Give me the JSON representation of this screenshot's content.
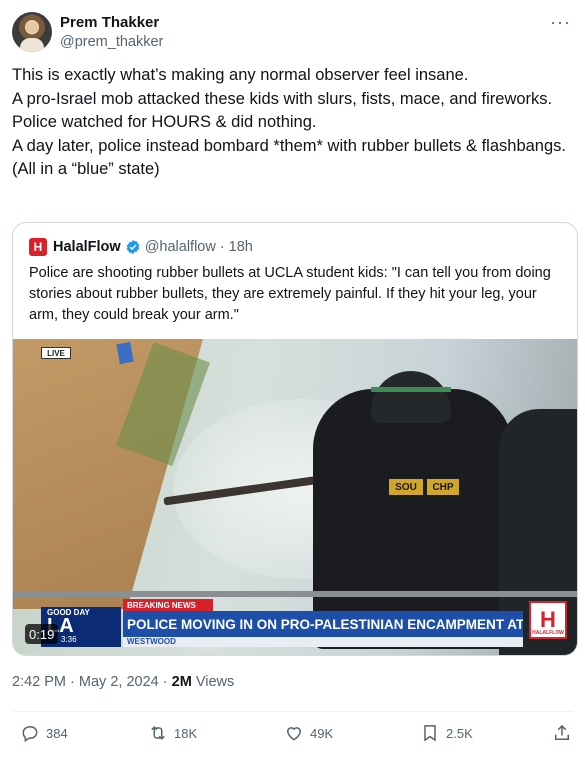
{
  "author": {
    "name": "Prem Thakker",
    "handle": "@prem_thakker"
  },
  "more_label": "···",
  "tweet": {
    "text": "This is exactly what’s making any normal observer feel insane.\nA pro-Israel mob attacked these kids with slurs, fists, mace, and fireworks. Police watched for HOURS & did nothing.\nA day later, police instead bombard *them* with rubber bullets & flashbangs.\n(All in a “blue” state)"
  },
  "quote": {
    "logo_letter": "H",
    "name": "HalalFlow",
    "handle": "@halalflow",
    "separator": "·",
    "time": "18h",
    "text": "Police are shooting rubber bullets at UCLA student kids: \"I can tell you from doing stories about rubber bullets, they are extremely painful. If they hit your leg, your arm, they could break your arm.\"",
    "video": {
      "live_label": "LIVE",
      "breaking": "BREAKING NEWS",
      "headline": "POLICE MOVING IN ON PRO-PALESTINIAN ENCAMPMENT AT UCLA",
      "location": "WESTWOOD",
      "show_small": "GOOD DAY",
      "show_big": "LA",
      "clock": "3:36",
      "patch_1": "SOU",
      "patch_2": "CHP",
      "corner_logo_letter": "H",
      "corner_logo_text": "HALALFLOW",
      "duration": "0:19"
    }
  },
  "timestamp": {
    "time": "2:42 PM",
    "date": "May 2, 2024",
    "separator": "·",
    "views": "2M",
    "views_label": "Views"
  },
  "actions": {
    "replies": "384",
    "reposts": "18K",
    "likes": "49K",
    "bookmarks": "2.5K"
  }
}
